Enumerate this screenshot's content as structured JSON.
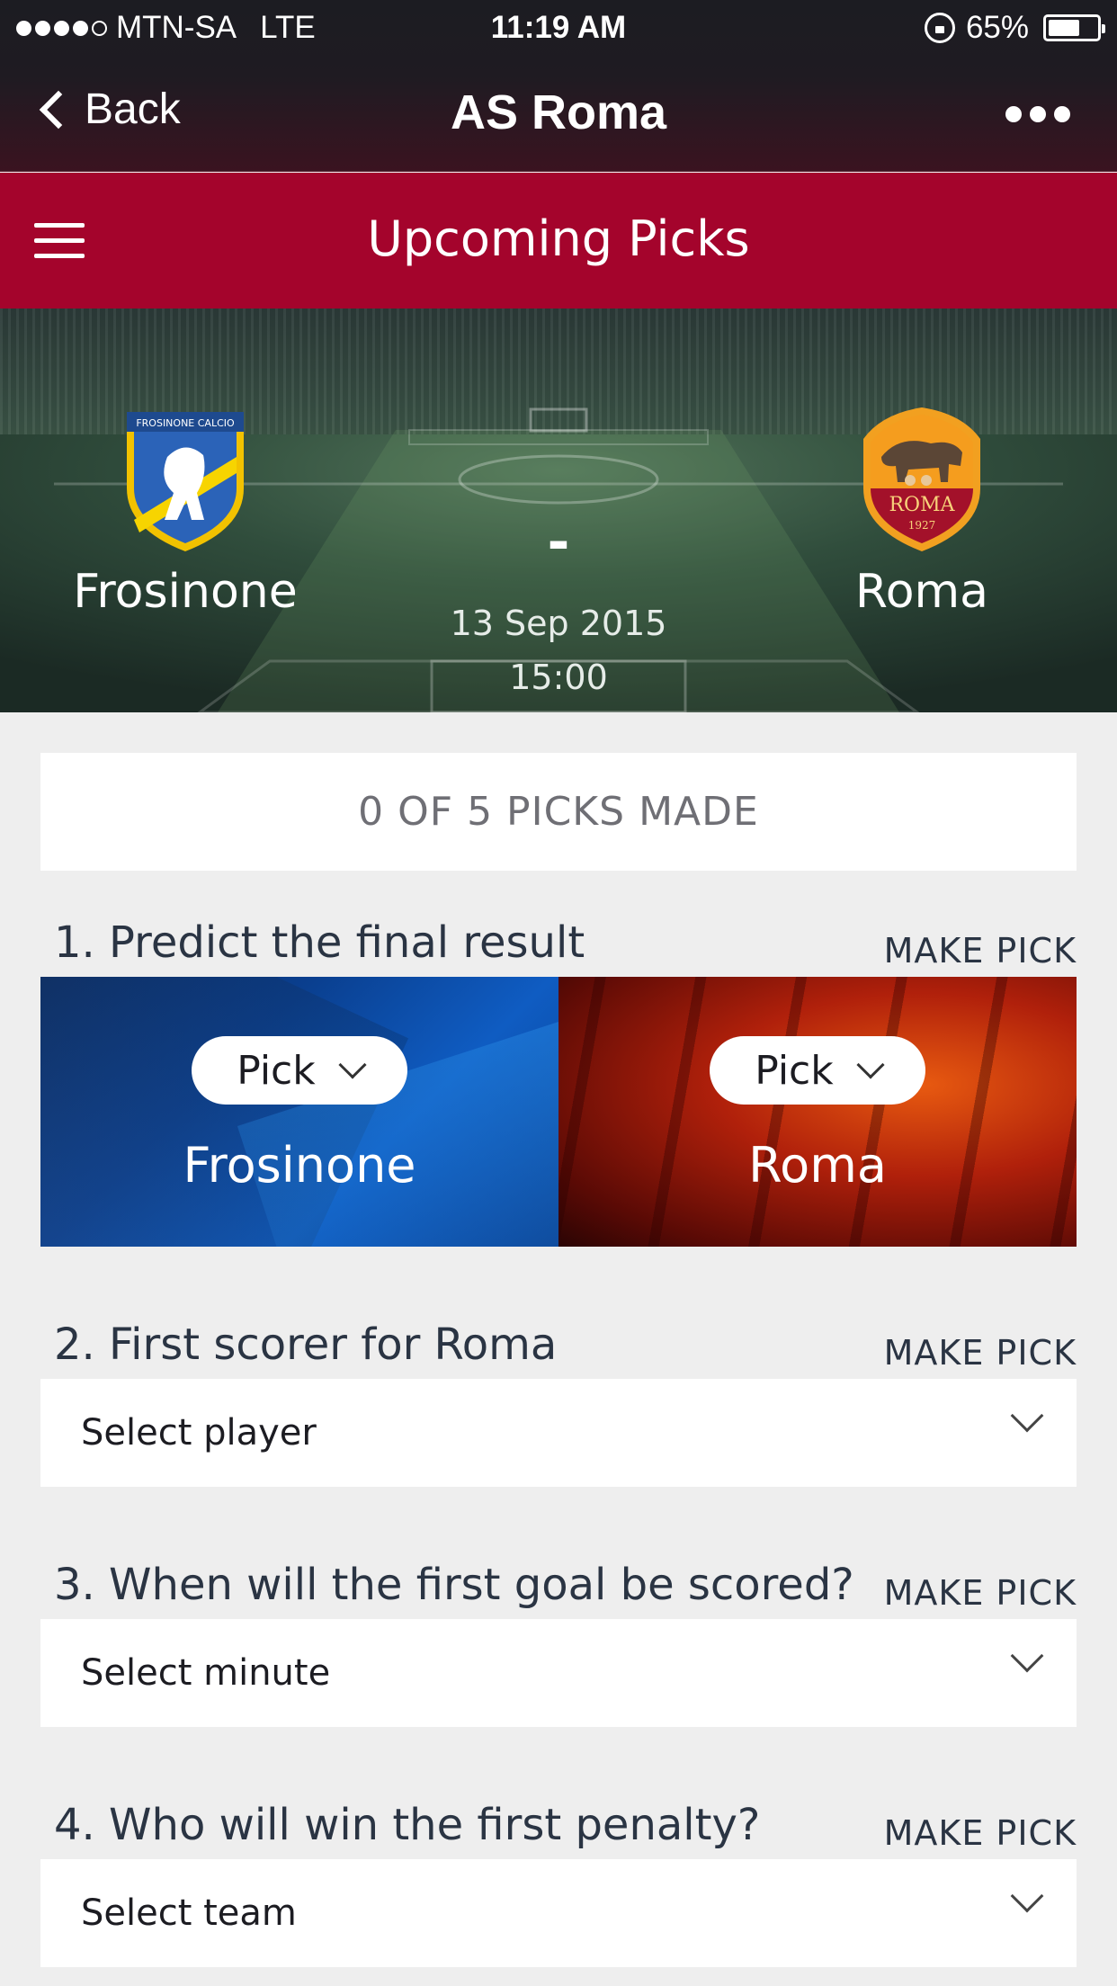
{
  "status_bar": {
    "carrier": "MTN-SA",
    "network": "LTE",
    "time": "11:19 AM",
    "battery": "65%",
    "battery_level": 0.65,
    "signal_bars": 4,
    "signal_max": 5
  },
  "nav": {
    "back_label": "Back",
    "title": "AS Roma"
  },
  "section": {
    "title": "Upcoming Picks"
  },
  "match": {
    "home_team": "Frosinone",
    "away_team": "Roma",
    "score": "-",
    "date": "13 Sep 2015",
    "time": "15:00",
    "home_crest_text": "FROSINONE CALCIO",
    "away_crest_text": "ROMA",
    "away_crest_year": "1927"
  },
  "progress": {
    "label": "0 OF 5 PICKS MADE"
  },
  "questions": [
    {
      "label": "1. Predict the final result",
      "action": "MAKE PICK",
      "home_pick": "Pick",
      "away_pick": "Pick",
      "home_team": "Frosinone",
      "away_team": "Roma"
    },
    {
      "label": "2. First scorer for Roma",
      "action": "MAKE PICK",
      "placeholder": "Select player"
    },
    {
      "label": "3. When will the first goal be scored?",
      "action": "MAKE PICK",
      "placeholder": "Select minute"
    },
    {
      "label": "4. Who will win the first penalty?",
      "action": "MAKE PICK",
      "placeholder": "Select team"
    }
  ],
  "colors": {
    "accent": "#a4042c",
    "home_panel": "#0a3f8f",
    "away_panel": "#b0200b",
    "background": "#eeeeee"
  }
}
